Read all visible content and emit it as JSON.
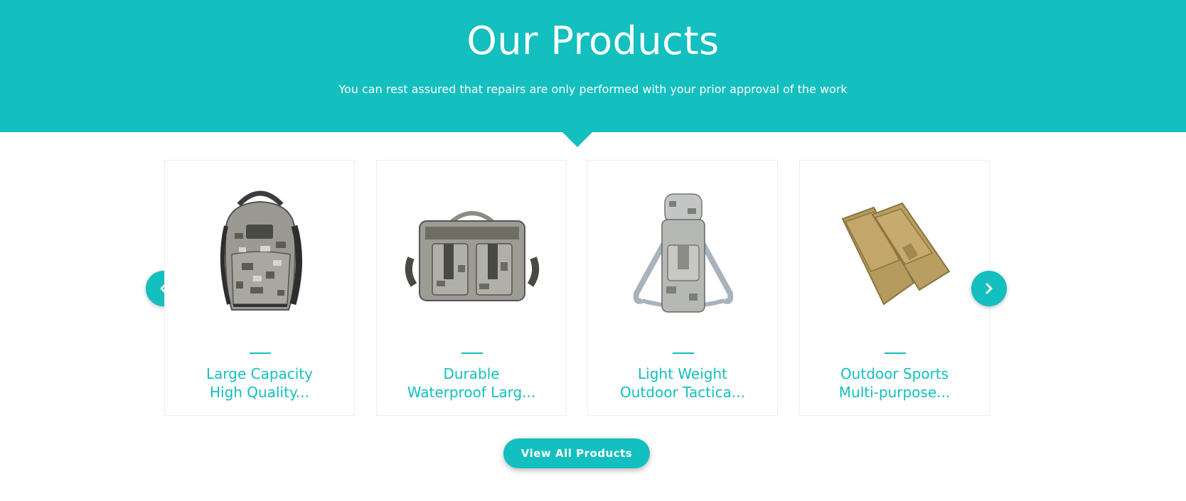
{
  "header": {
    "title": "Our Products",
    "subtitle": "You can rest assured that repairs are only performed with your prior approval of the work"
  },
  "carousel": {
    "prev_icon": "chevron-left-icon",
    "next_icon": "chevron-right-icon"
  },
  "products": [
    {
      "line1": "Large Capacity",
      "line2": "High Quality...",
      "image": "camo-backpack"
    },
    {
      "line1": "Durable",
      "line2": "Waterproof Larg...",
      "image": "camo-messenger-bag"
    },
    {
      "line1": "Light Weight",
      "line2": "Outdoor Tactica...",
      "image": "camo-bottle-pouch"
    },
    {
      "line1": "Outdoor Sports",
      "line2": "Multi-purpose...",
      "image": "tan-phone-pouch"
    }
  ],
  "footer": {
    "view_all_label": "View All Products"
  },
  "colors": {
    "accent": "#13bfbf",
    "text_white": "#ffffff"
  }
}
